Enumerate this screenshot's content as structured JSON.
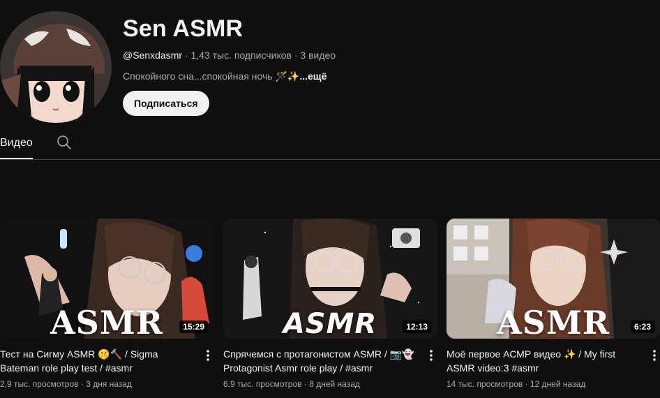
{
  "channel": {
    "name": "Sen ASMR",
    "handle": "@Senxdasmr",
    "subscribers": "1,43 тыс. подписчиков",
    "video_count": "3 видео",
    "separator": " · ",
    "description": "Спокойного сна...спокойная ночь 🪄✨",
    "more_label": "...ещё",
    "subscribe_label": "Подписаться"
  },
  "tabs": {
    "videos_label": "Видео",
    "search_icon": "search-icon"
  },
  "videos": [
    {
      "title": "Тест на Сигму ASMR 🤫🔨 / Sigma Bateman role play test / #asmr",
      "duration": "15:29",
      "views": "2,9 тыс. просмотров",
      "age": "3 дня назад",
      "thumb_text": "ASMR"
    },
    {
      "title": "Спрячемся с протагонистом ASMR / 📷👻 Protagonist Asmr role play / #asmr",
      "duration": "12:13",
      "views": "6,9 тыс. просмотров",
      "age": "8 дней назад",
      "thumb_text": "ASMR"
    },
    {
      "title": "Моё первое АСМР видео ✨ / My first ASMR video:3 #asmr",
      "duration": "6:23",
      "views": "14 тыс. просмотров",
      "age": "12 дней назад",
      "thumb_text": "ASMR"
    }
  ],
  "colors": {
    "background": "#0f0f0f",
    "text_primary": "#f1f1f1",
    "text_secondary": "#aaaaaa",
    "divider": "#3f3f3f"
  }
}
